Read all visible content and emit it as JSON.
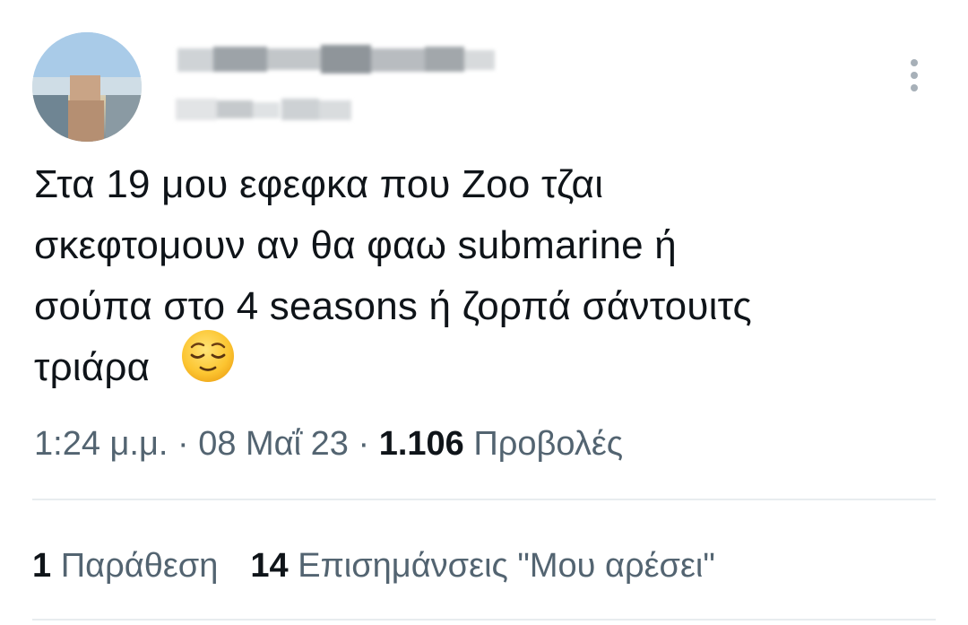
{
  "tweet": {
    "text_lines": [
      "Στα 19 μου εφεφκα που Zoo τζαι",
      "σκεφτομουν αν θα φαω submarine ή",
      "σούπα στο 4 seasons ή ζορπά σάντουιτς",
      "τριάρα"
    ],
    "emoji": "relieved-face-emoji"
  },
  "meta": {
    "time": "1:24 μ.μ.",
    "separator": "·",
    "date": "08 Μαΐ 23",
    "views_count": "1.106",
    "views_label": "Προβολές"
  },
  "stats": {
    "quotes_count": "1",
    "quotes_label": "Παράθεση",
    "likes_count": "14",
    "likes_label": "Επισημάνσεις \"Μου αρέσει\""
  },
  "icons": {
    "more": "more-vertical-icon"
  },
  "colors": {
    "text": "#0f1419",
    "secondary": "#536471",
    "divider": "#e8ecef",
    "more_dots": "#a7b0b8"
  }
}
